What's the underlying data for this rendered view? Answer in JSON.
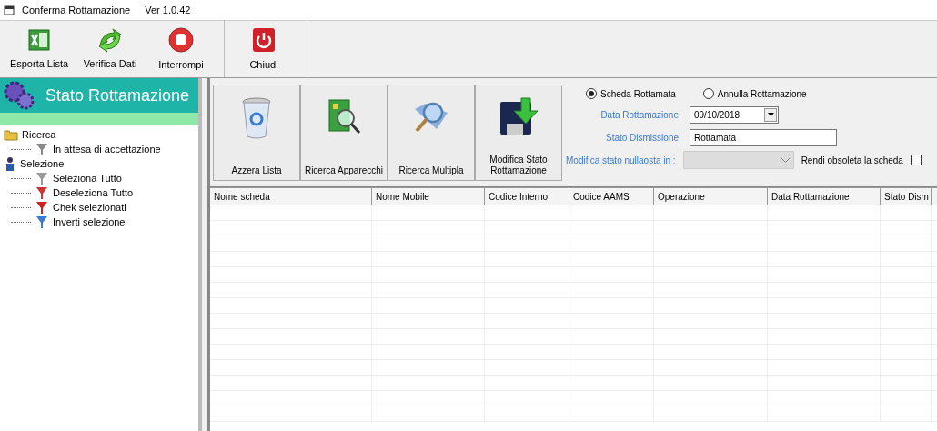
{
  "window": {
    "title": "Conferma Rottamazione",
    "version": "Ver 1.0.42"
  },
  "toolbar": [
    [
      "Esporta Lista",
      "Verifica Dati",
      "Interrompi"
    ],
    [
      "Chiudi"
    ]
  ],
  "sidebar": {
    "title": "Stato Rottamazione",
    "tree": [
      {
        "label": "Ricerca",
        "children": [
          {
            "label": "In attesa di accettazione"
          }
        ]
      },
      {
        "label": "Selezione",
        "children": [
          {
            "label": "Seleziona Tutto"
          },
          {
            "label": "Deseleziona Tutto"
          },
          {
            "label": "Chek selezionati"
          },
          {
            "label": "Inverti selezione"
          }
        ]
      }
    ]
  },
  "actions": [
    {
      "label": "Azzera Lista"
    },
    {
      "label": "Ricerca Apparecchi"
    },
    {
      "label": "Ricerca Multipla"
    },
    {
      "label": "Modifica Stato Rottamazione"
    }
  ],
  "form": {
    "radios": [
      {
        "label": "Scheda Rottamata",
        "selected": true
      },
      {
        "label": "Annulla Rottamazione",
        "selected": false
      }
    ],
    "date": {
      "label": "Data Rottamazione",
      "value": "09/10/2018"
    },
    "stato": {
      "label": "Stato Dismissione",
      "value": "Rottamata"
    },
    "nullaosta": {
      "label": "Modifica stato nullaosta in :",
      "disabled": true
    },
    "obsoleta": {
      "label": "Rendi obsoleta la scheda",
      "checked": false
    }
  },
  "table": {
    "columns": [
      "Nome scheda",
      "Nome Mobile",
      "Codice Interno",
      "Codice AAMS",
      "Operazione",
      "Data Rottamazione",
      "Stato Dism"
    ]
  }
}
